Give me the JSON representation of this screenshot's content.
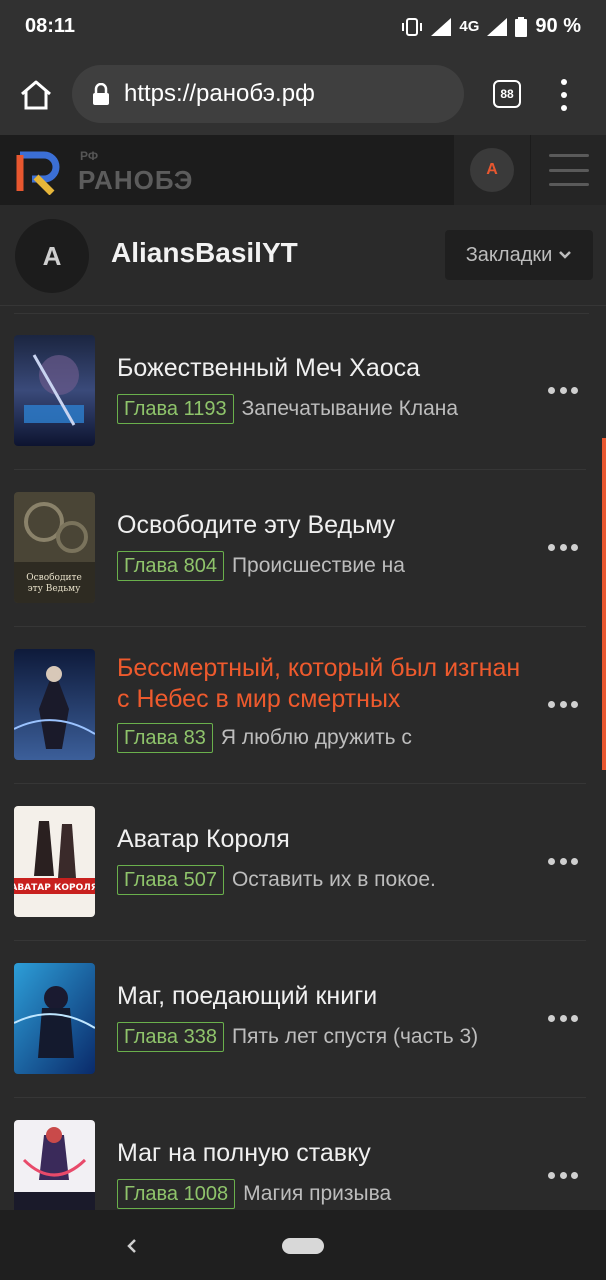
{
  "status": {
    "time": "08:11",
    "network": "4G",
    "battery": "90 %"
  },
  "browser": {
    "url": "https://ранобэ.рф",
    "tabs_count": "88"
  },
  "site": {
    "logo_small": "РФ",
    "logo_text": "РАНОБЭ",
    "header_avatar_letter": "A"
  },
  "user": {
    "avatar_letter": "A",
    "name": "AliansBasilYT",
    "bookmarks_label": "Закладки"
  },
  "colors": {
    "accent": "#ee5a2d",
    "chapter_green": "#8fc46b",
    "bg": "#2a2a2a"
  },
  "items": [
    {
      "title": "Божественный Меч Хаоса",
      "chapter": "Глава 1193",
      "chapter_name": "Запечатывание Клана",
      "highlight": false
    },
    {
      "title": "Освободите эту Ведьму",
      "chapter": "Глава 804",
      "chapter_name": "Происшествие на",
      "highlight": false
    },
    {
      "title": "Бессмертный, который был изгнан с Небес в мир смертных",
      "chapter": "Глава 83",
      "chapter_name": "Я люблю дружить с",
      "highlight": true
    },
    {
      "title": "Аватар Короля",
      "chapter": "Глава 507",
      "chapter_name": "Оставить их в покое.",
      "highlight": false
    },
    {
      "title": "Маг, поедающий книги",
      "chapter": "Глава 338",
      "chapter_name": "Пять лет спустя (часть 3)",
      "highlight": false
    },
    {
      "title": "Маг на полную ставку",
      "chapter": "Глава 1008",
      "chapter_name": "Магия призыва",
      "highlight": false
    }
  ]
}
